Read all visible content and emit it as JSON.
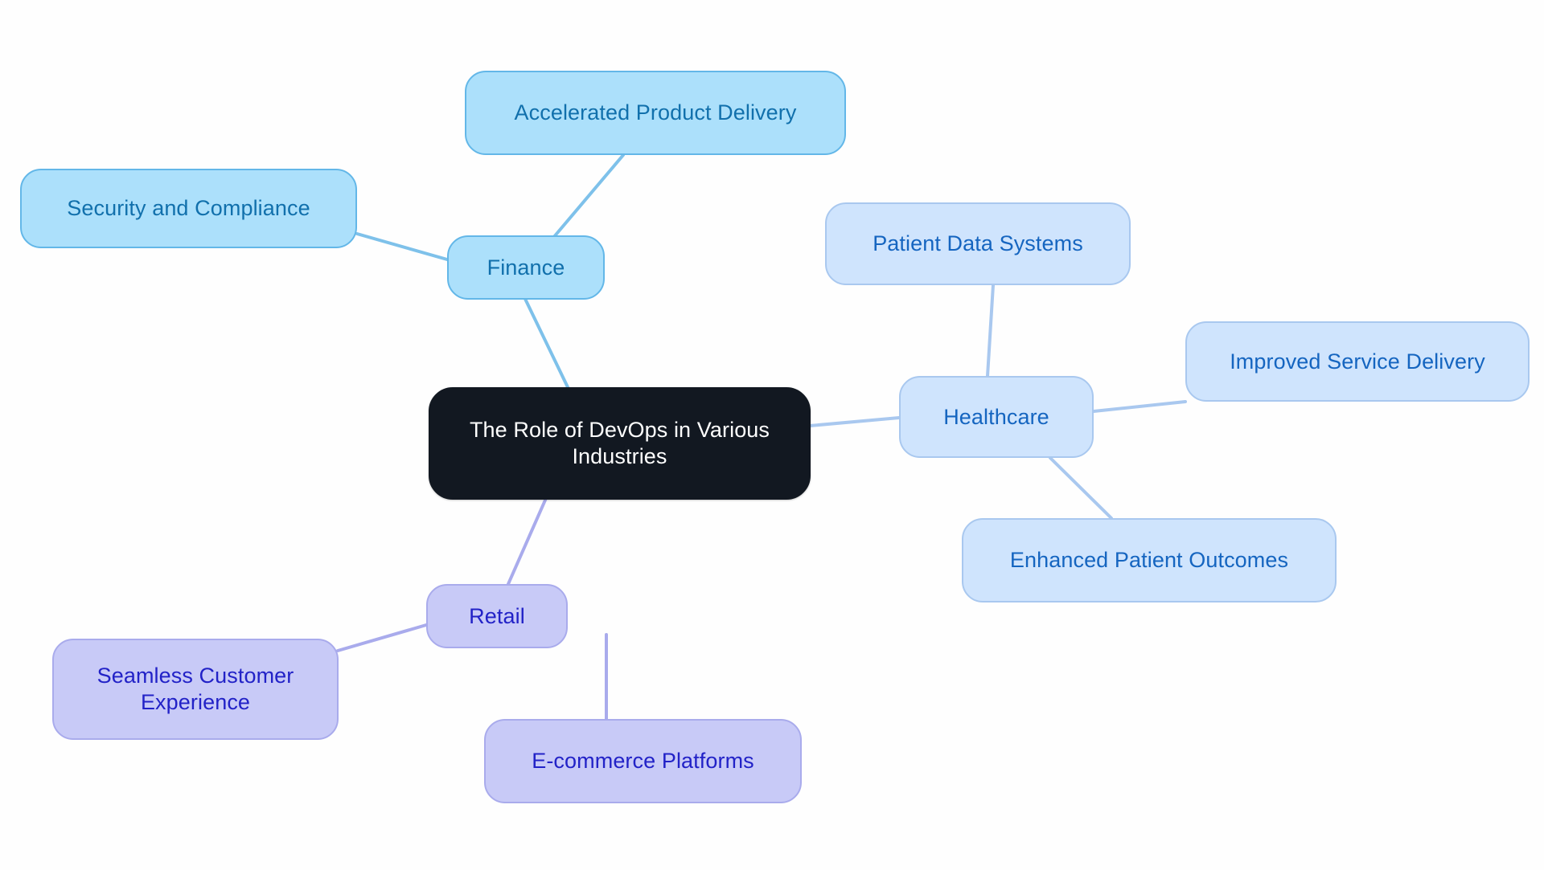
{
  "diagram": {
    "type": "mindmap",
    "background_color": "#fefefe",
    "root": {
      "id": "root",
      "label": "The Role of DevOps in Various\nIndustries",
      "fill": "#121821",
      "text_color": "#ffffff"
    },
    "branches": [
      {
        "id": "finance",
        "label": "Finance",
        "fill": "#ace0fb",
        "border": "#63b7e8",
        "text_color": "#1170ac",
        "edge_color": "#7ec1ea",
        "children": [
          {
            "id": "accelerated-product-delivery",
            "label": "Accelerated Product Delivery"
          },
          {
            "id": "security-and-compliance",
            "label": "Security and Compliance"
          }
        ]
      },
      {
        "id": "healthcare",
        "label": "Healthcare",
        "fill": "#cfe4fd",
        "border": "#a9c8ef",
        "text_color": "#1565c0",
        "edge_color": "#a9c8ef",
        "children": [
          {
            "id": "patient-data-systems",
            "label": "Patient Data Systems"
          },
          {
            "id": "improved-service-delivery",
            "label": "Improved Service Delivery"
          },
          {
            "id": "enhanced-patient-outcomes",
            "label": "Enhanced Patient Outcomes"
          }
        ]
      },
      {
        "id": "retail",
        "label": "Retail",
        "fill": "#c8caf7",
        "border": "#a9abec",
        "text_color": "#2222c7",
        "edge_color": "#a9abec",
        "children": [
          {
            "id": "seamless-customer-experience",
            "label": "Seamless Customer\nExperience"
          },
          {
            "id": "e-commerce-platforms",
            "label": "E-commerce Platforms"
          }
        ]
      }
    ]
  },
  "nodes": {
    "root": "The Role of DevOps in Various\nIndustries",
    "finance": "Finance",
    "accelerated_product_delivery": "Accelerated Product Delivery",
    "security_and_compliance": "Security and Compliance",
    "healthcare": "Healthcare",
    "patient_data_systems": "Patient Data Systems",
    "improved_service_delivery": "Improved Service Delivery",
    "enhanced_patient_outcomes": "Enhanced Patient Outcomes",
    "retail": "Retail",
    "seamless_customer_experience": "Seamless Customer\nExperience",
    "e_commerce_platforms": "E-commerce Platforms"
  }
}
